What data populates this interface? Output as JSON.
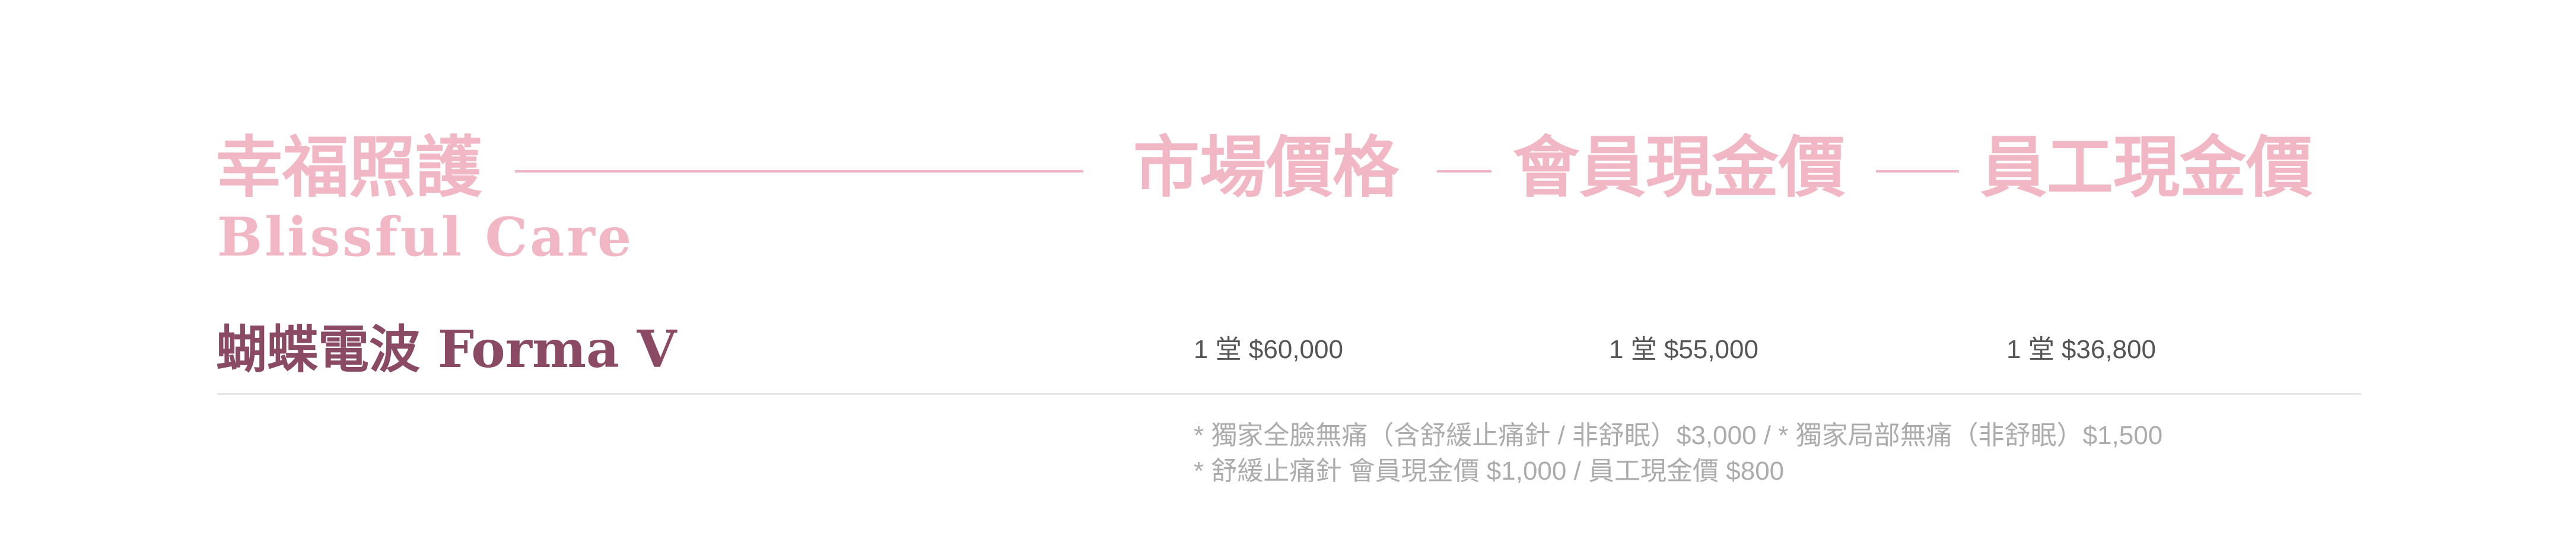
{
  "section": {
    "title_zh": "幸福照護",
    "title_en": "Blissful Care",
    "columns": [
      "市場價格",
      "會員現金價",
      "員工現金價"
    ]
  },
  "item": {
    "name": "蝴蝶電波 Forma V",
    "market_price": "1 堂 $60,000",
    "member_price": "1 堂 $55,000",
    "staff_price": "1 堂 $36,800"
  },
  "notes": [
    "* 獨家全臉無痛（含舒緩止痛針 / 非舒眠）$3,000  /  * 獨家局部無痛（非舒眠）$1,500",
    "* 舒緩止痛針  會員現金價 $1,000 / 員工現金價 $800"
  ],
  "colors": {
    "accent_pink": "#F2B7C4",
    "item_name": "#8B4A63",
    "price_text": "#555555",
    "note_text": "#ACACAC",
    "divider": "#E6E6E6"
  }
}
